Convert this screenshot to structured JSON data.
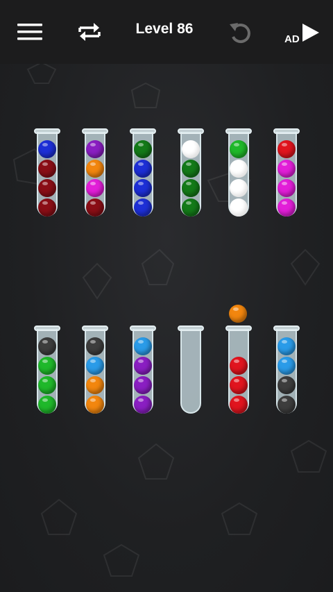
{
  "header": {
    "level_title": "Level 86",
    "ad_label": "AD",
    "icons": [
      "hamburger-menu-icon",
      "shuffle-icon",
      "undo-icon",
      "play-icon"
    ]
  },
  "colors": {
    "blue": "#1d2fd6",
    "darkred": "#8a0e16",
    "red": "#e0141e",
    "purple": "#8a1ec2",
    "orange": "#f2860e",
    "magenta": "#e21ed8",
    "darkgreen": "#137a18",
    "green": "#1fb82a",
    "white": "#ffffff",
    "skyblue": "#2a9be8",
    "gray": "#3d3d3d"
  },
  "board": {
    "tubes": [
      {
        "id": "tube-1",
        "balls_top_to_bottom": [
          "blue",
          "darkred",
          "darkred",
          "darkred"
        ]
      },
      {
        "id": "tube-2",
        "balls_top_to_bottom": [
          "purple",
          "orange",
          "magenta",
          "darkred"
        ]
      },
      {
        "id": "tube-3",
        "balls_top_to_bottom": [
          "darkgreen",
          "blue",
          "blue",
          "blue"
        ]
      },
      {
        "id": "tube-4",
        "balls_top_to_bottom": [
          "white",
          "darkgreen",
          "darkgreen",
          "darkgreen"
        ]
      },
      {
        "id": "tube-5",
        "balls_top_to_bottom": [
          "green",
          "white",
          "white",
          "white"
        ]
      },
      {
        "id": "tube-6",
        "balls_top_to_bottom": [
          "red",
          "magenta",
          "magenta",
          "magenta"
        ]
      },
      {
        "id": "tube-7",
        "balls_top_to_bottom": [
          "gray",
          "green",
          "green",
          "green"
        ]
      },
      {
        "id": "tube-8",
        "balls_top_to_bottom": [
          "gray",
          "skyblue",
          "orange",
          "orange"
        ]
      },
      {
        "id": "tube-9",
        "balls_top_to_bottom": [
          "skyblue",
          "purple",
          "purple",
          "purple"
        ]
      },
      {
        "id": "tube-10",
        "balls_top_to_bottom": []
      },
      {
        "id": "tube-11",
        "balls_top_to_bottom": [
          "red",
          "red",
          "red"
        ]
      },
      {
        "id": "tube-12",
        "balls_top_to_bottom": [
          "skyblue",
          "skyblue",
          "gray",
          "gray"
        ]
      }
    ],
    "lifted_ball": {
      "color": "orange",
      "from_tube": "tube-11"
    }
  }
}
